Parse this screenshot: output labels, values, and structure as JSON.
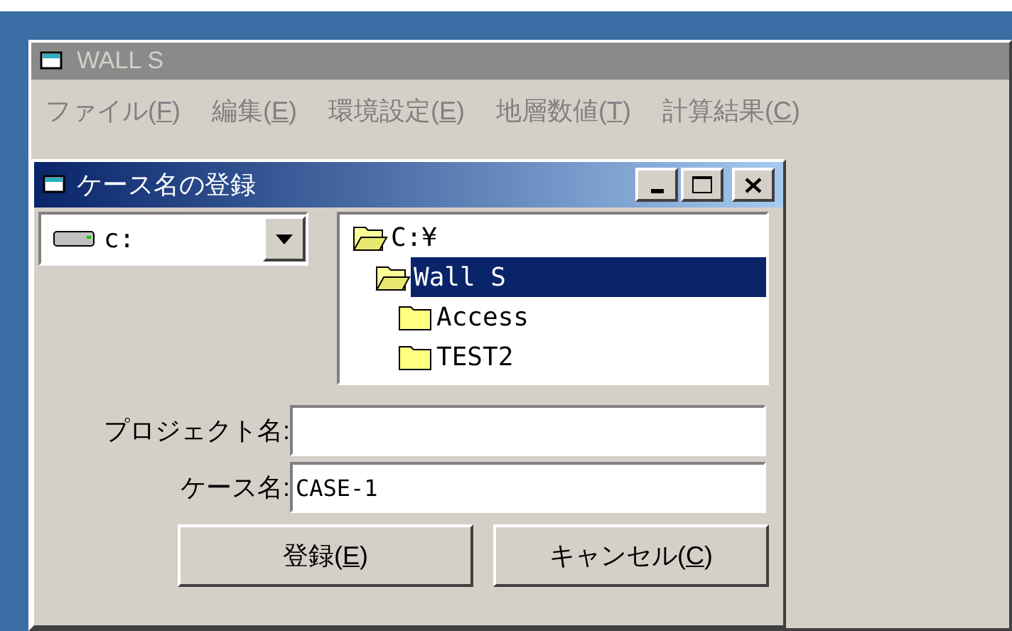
{
  "main_window": {
    "title": "WALL S",
    "active": false
  },
  "menu": [
    {
      "text": "ファイル(",
      "mnemonic": "F",
      "rest": ")"
    },
    {
      "text": "編集(",
      "mnemonic": "E",
      "rest": ")"
    },
    {
      "text": "環境設定(",
      "mnemonic": "E",
      "rest": ")"
    },
    {
      "text": "地層数値(",
      "mnemonic": "T",
      "rest": ")"
    },
    {
      "text": "計算結果(",
      "mnemonic": "C",
      "rest": ")"
    }
  ],
  "dialog": {
    "title": "ケース名の登録",
    "active": true,
    "drive": {
      "value": "c:"
    },
    "folders": [
      {
        "label": "C:¥",
        "selected": false,
        "open": true,
        "children": [
          {
            "label": "Wall S",
            "selected": true,
            "open": true,
            "children": [
              {
                "label": "Access",
                "selected": false,
                "open": false
              },
              {
                "label": "TEST2",
                "selected": false,
                "open": false
              }
            ]
          }
        ]
      }
    ],
    "fields": [
      {
        "label": "プロジェクト名:"
      },
      {
        "label": "ケース名:",
        "value": "CASE-1"
      }
    ],
    "buttons": [
      {
        "text": "登録(",
        "mnemonic": "E",
        "rest": ")"
      },
      {
        "text": "キャンセル(",
        "mnemonic": "C",
        "rest": ")"
      }
    ]
  }
}
